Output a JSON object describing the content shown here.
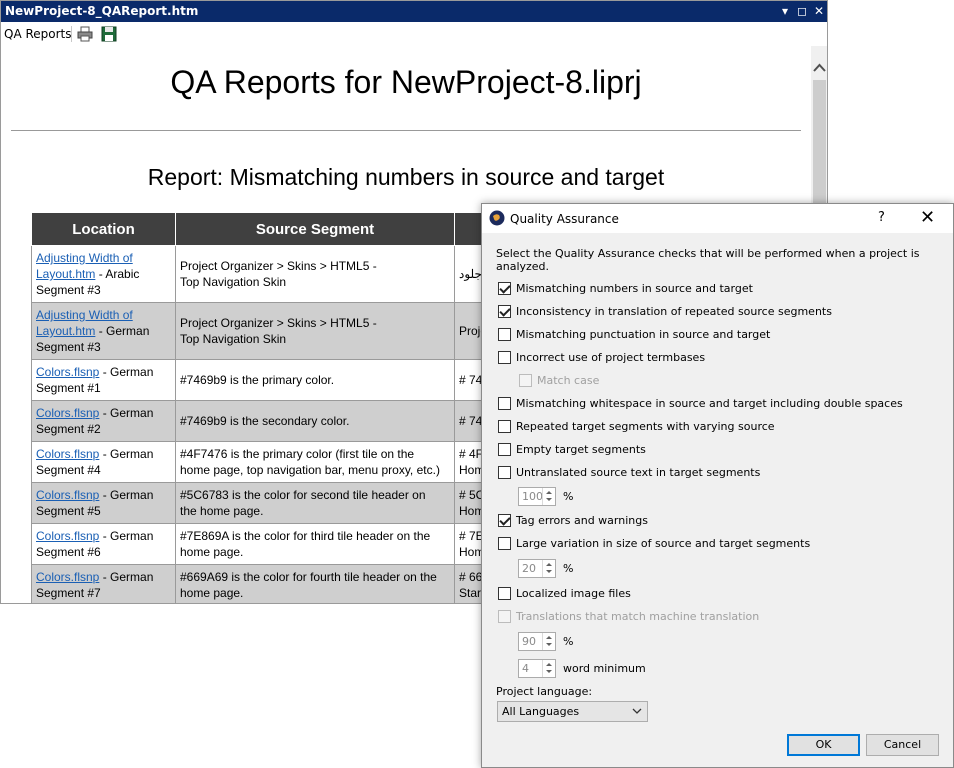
{
  "report_window": {
    "title": "NewProject-8_QAReport.htm",
    "title_buttons": {
      "minimize_glyph": "▾",
      "maximize_glyph": "◻",
      "close_glyph": "✕"
    },
    "toolbar": {
      "label": "QA Reports",
      "print_icon": "printer-icon",
      "save_icon": "save-icon"
    },
    "heading": "QA Reports for NewProject-8.liprj",
    "subheading": "Report: Mismatching numbers in source and target",
    "table": {
      "headers": [
        "Location",
        "Source Segment",
        ""
      ],
      "rows": [
        {
          "link": "Adjusting Width of",
          "link2": "Layout.htm",
          "lang": " - Arabic",
          "seg": "Segment #3",
          "src1": "Project Organizer > Skins > HTML5 -",
          "src2": " Top Navigation Skin",
          "tgt1": "جلود",
          "tgt2": ""
        },
        {
          "link": "Adjusting Width of",
          "link2": "Layout.htm",
          "lang": " - German",
          "seg": "Segment #3",
          "src1": "Project Organizer > Skins > HTML5 -",
          "src2": " Top Navigation Skin",
          "tgt1": "Proje",
          "tgt2": ""
        },
        {
          "link": "Colors.flsnp",
          "link2": "",
          "lang": " - German",
          "seg": "Segment #1",
          "src1": "#7469b9 is the primary color.",
          "src2": "",
          "tgt1": "# 74",
          "tgt2": ""
        },
        {
          "link": "Colors.flsnp",
          "link2": "",
          "lang": " - German",
          "seg": "Segment #2",
          "src1": "#7469b9 is the secondary color.",
          "src2": "",
          "tgt1": "# 74",
          "tgt2": ""
        },
        {
          "link": "Colors.flsnp",
          "link2": "",
          "lang": " - German",
          "seg": "Segment #4",
          "src1": "#4F7476 is the primary color (first tile on the",
          "src2": "home page, top navigation bar, menu proxy, etc.)",
          "tgt1": "# 4F",
          "tgt2": "Hom"
        },
        {
          "link": "Colors.flsnp",
          "link2": "",
          "lang": " - German",
          "seg": "Segment #5",
          "src1": "#5C6783 is the color for second tile header on",
          "src2": "the home page.",
          "tgt1": "# 5C",
          "tgt2": "Hom"
        },
        {
          "link": "Colors.flsnp",
          "link2": "",
          "lang": " - German",
          "seg": "Segment #6",
          "src1": "#7E869A is the color for third tile header on the",
          "src2": "home page.",
          "tgt1": "# 7E",
          "tgt2": "Hom"
        },
        {
          "link": "Colors.flsnp",
          "link2": "",
          "lang": " - German",
          "seg": "Segment #7",
          "src1": "#669A69 is the color for fourth tile header on the",
          "src2": "home page.",
          "tgt1": "# 66",
          "tgt2": "Star"
        }
      ]
    }
  },
  "qa_dialog": {
    "title": "Quality Assurance",
    "help_glyph": "?",
    "close_glyph": "✕",
    "instructions": "Select the Quality Assurance checks that will be performed when a project is analyzed.",
    "checks": [
      {
        "label": "Mismatching numbers in source and target",
        "checked": true,
        "enabled": true
      },
      {
        "label": "Inconsistency in translation of repeated source segments",
        "checked": true,
        "enabled": true
      },
      {
        "label": "Mismatching punctuation in source and target",
        "checked": false,
        "enabled": true
      },
      {
        "label": "Incorrect use of project termbases",
        "checked": false,
        "enabled": true
      },
      {
        "label": "Match case",
        "checked": false,
        "enabled": false
      },
      {
        "label": "Mismatching whitespace in source and target including double spaces",
        "checked": false,
        "enabled": true
      },
      {
        "label": "Repeated target segments with varying source",
        "checked": false,
        "enabled": true
      },
      {
        "label": "Empty target segments",
        "checked": false,
        "enabled": true
      },
      {
        "label": "Untranslated source text in target segments",
        "checked": false,
        "enabled": true
      },
      {
        "label": "Tag errors and warnings",
        "checked": true,
        "enabled": true
      },
      {
        "label": "Large variation in size of source and target segments",
        "checked": false,
        "enabled": true
      },
      {
        "label": "Localized image files",
        "checked": false,
        "enabled": true
      },
      {
        "label": "Translations that match machine translation",
        "checked": false,
        "enabled": false
      }
    ],
    "spinners": [
      {
        "value": "100",
        "unit": "%"
      },
      {
        "value": "20",
        "unit": "%"
      },
      {
        "value": "90",
        "unit": "%"
      },
      {
        "value": "4",
        "unit": "word minimum"
      }
    ],
    "language_label": "Project language:",
    "language_value": "All Languages",
    "ok_label": "OK",
    "cancel_label": "Cancel"
  }
}
